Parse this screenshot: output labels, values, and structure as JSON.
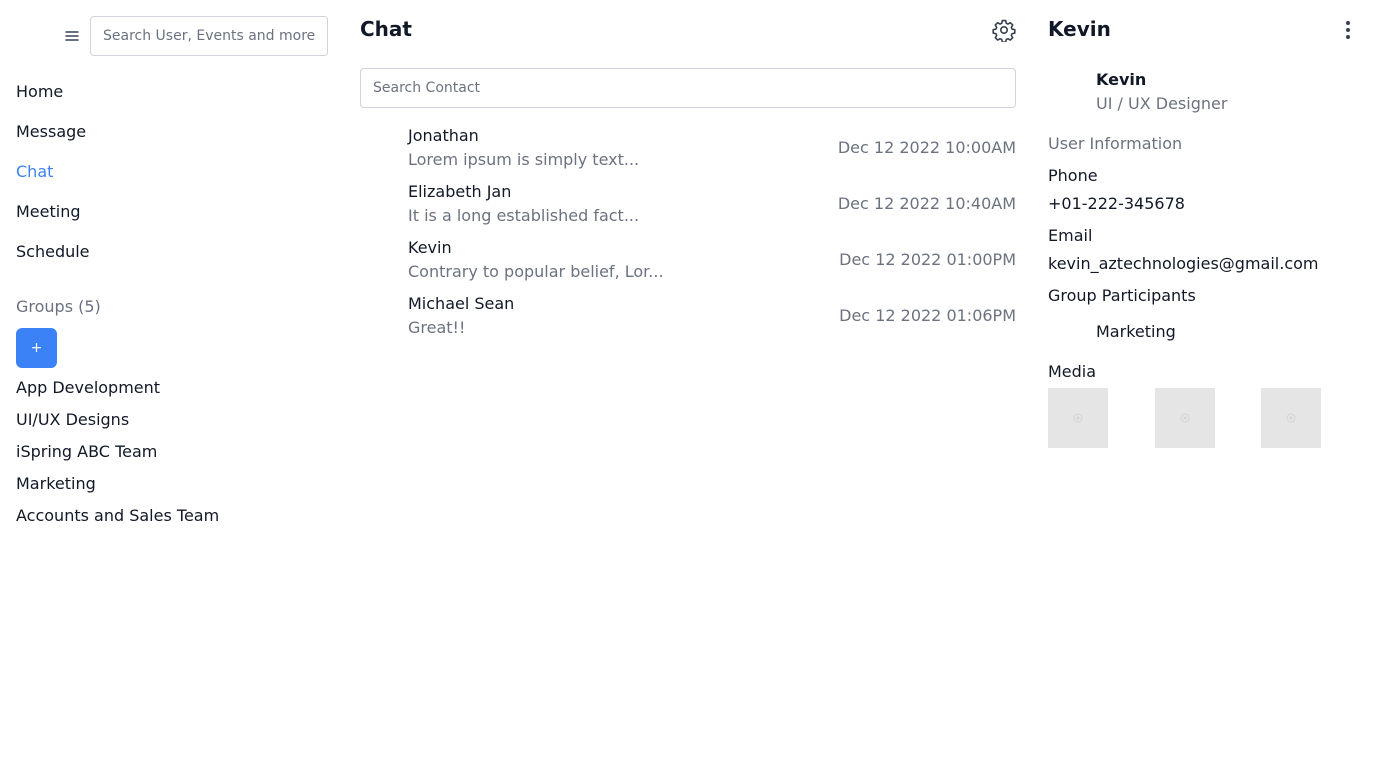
{
  "sidebar": {
    "search_placeholder": "Search User, Events and more.",
    "nav": [
      {
        "label": "Home",
        "active": false
      },
      {
        "label": "Message",
        "active": false
      },
      {
        "label": "Chat",
        "active": true
      },
      {
        "label": "Meeting",
        "active": false
      },
      {
        "label": "Schedule",
        "active": false
      }
    ],
    "groups_heading": "Groups (5)",
    "add_group_label": "+",
    "groups": [
      "App Development",
      "UI/UX Designs",
      "iSpring ABC Team",
      "Marketing",
      "Accounts and Sales Team"
    ],
    "icons": {
      "menu": "hamburger-menu-icon"
    }
  },
  "chat": {
    "title": "Chat",
    "search_placeholder": "Search Contact",
    "icons": {
      "settings": "gear-icon"
    },
    "conversations": [
      {
        "name": "Jonathan",
        "preview": "Lorem ipsum is simply text...",
        "time": "Dec 12 2022 10:00AM"
      },
      {
        "name": "Elizabeth Jan",
        "preview": "It is a long established fact...",
        "time": "Dec 12 2022 10:40AM"
      },
      {
        "name": "Kevin",
        "preview": "Contrary to popular belief, Lor...",
        "time": "Dec 12 2022 01:00PM"
      },
      {
        "name": "Michael Sean",
        "preview": "Great!!",
        "time": "Dec 12 2022 01:06PM"
      }
    ]
  },
  "profile": {
    "title": "Kevin",
    "name": "Kevin",
    "role": "UI / UX Designer",
    "info_heading": "User Information",
    "phone_label": "Phone",
    "phone": "+01-222-345678",
    "email_label": "Email",
    "email": "kevin_aztechnologies@gmail.com",
    "participants_label": "Group Participants",
    "participants": [
      "Marketing"
    ],
    "media_label": "Media",
    "media_count": 3,
    "icons": {
      "more": "vertical-dots-icon"
    }
  },
  "colors": {
    "accent": "#3b82f6",
    "text": "#111827",
    "muted": "#6b7280",
    "border": "#d1d5db",
    "media_placeholder": "#e5e5e5"
  }
}
